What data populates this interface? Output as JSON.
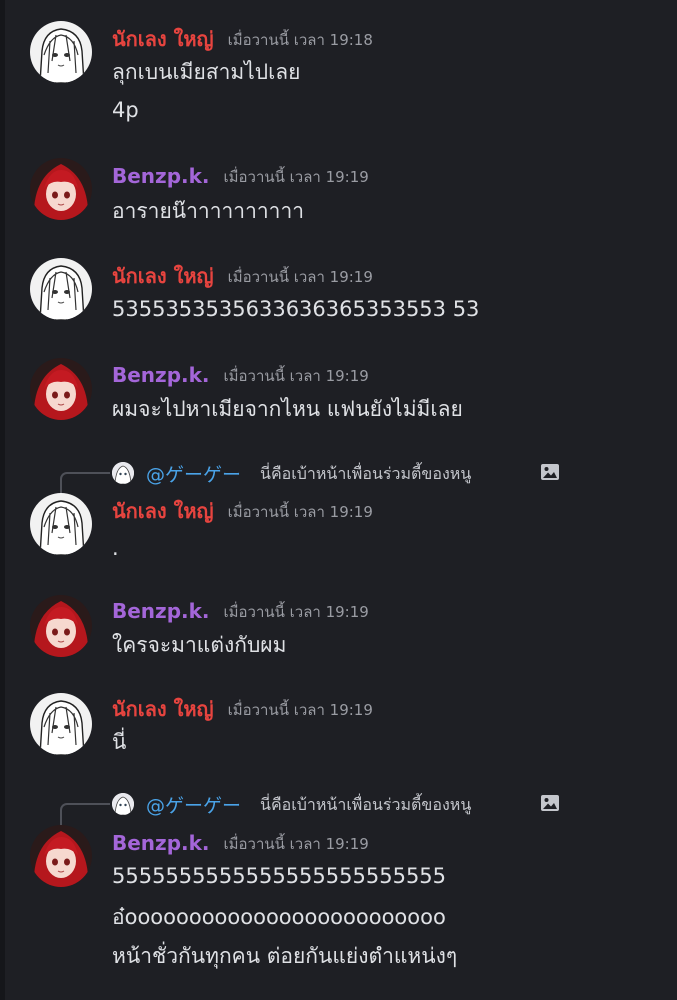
{
  "messages": [
    {
      "author": "นักเลง ใหญ่",
      "timestamp": "เมื่อวานนี้ เวลา 19:18",
      "lines": [
        "ลุกเบนเมียสามไปเลย",
        "4p"
      ]
    },
    {
      "author": "Benzp.k.",
      "timestamp": "เมื่อวานนี้ เวลา 19:19",
      "lines": [
        "อารายน๊าาาาาาาาาา"
      ]
    },
    {
      "author": "นักเลง ใหญ่",
      "timestamp": "เมื่อวานนี้ เวลา 19:19",
      "lines": [
        "5355353535633636365353553 53"
      ]
    },
    {
      "author": "Benzp.k.",
      "timestamp": "เมื่อวานนี้ เวลา 19:19",
      "lines": [
        "ผมจะไปหาเมียจากไหน แฟนยังไม่มีเลย"
      ]
    },
    {
      "author": "นักเลง ใหญ่",
      "timestamp": "เมื่อวานนี้ เวลา 19:19",
      "lines": [
        "."
      ],
      "reply": {
        "author": "@ゲーゲー",
        "text": "นี่คือเบ้าหน้าเพื่อนร่วมตี้ของหนู"
      }
    },
    {
      "author": "Benzp.k.",
      "timestamp": "เมื่อวานนี้ เวลา 19:19",
      "lines": [
        "ใครจะมาแต่งกับผม"
      ]
    },
    {
      "author": "นักเลง ใหญ่",
      "timestamp": "เมื่อวานนี้ เวลา 19:19",
      "lines": [
        "นี่"
      ]
    },
    {
      "author": "Benzp.k.",
      "timestamp": "เมื่อวานนี้ เวลา 19:19",
      "lines": [
        "5555555555555555555555555",
        "อ๋ooooooooooooooooooooooooo",
        "หน้าชั่วกันทุกคน ต่อยกันแย่งตำแหน่งๆ"
      ],
      "reply": {
        "author": "@ゲーゲー",
        "text": "นี่คือเบ้าหน้าเพื่อนร่วมตี้ของหนู"
      }
    }
  ],
  "colors": {
    "background": "#1e1f24",
    "author_red": "#e7443f",
    "author_purple": "#a466d9",
    "mention_blue": "#4aa3e8",
    "timestamp": "#9a9ca3"
  },
  "icons": {
    "avatar_red": "red-haired-anime-avatar-icon",
    "avatar_sketch": "sketch-anime-avatar-icon",
    "attachment": "image-attachment-icon"
  }
}
